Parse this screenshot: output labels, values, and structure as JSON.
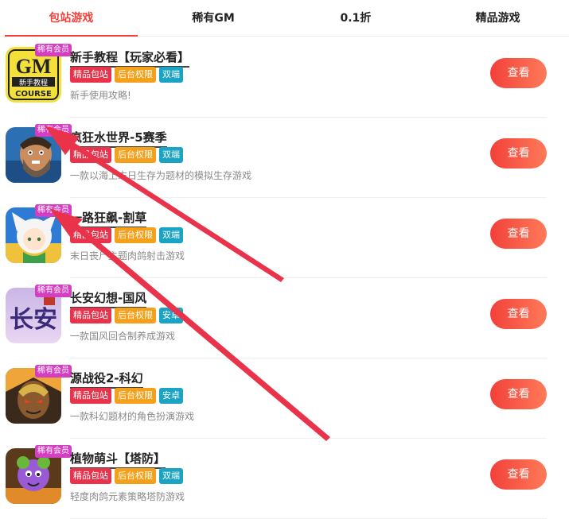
{
  "tabs": [
    {
      "label": "包站游戏",
      "active": true
    },
    {
      "label": "稀有GM",
      "active": false
    },
    {
      "label": "0.1折",
      "active": false
    },
    {
      "label": "精品游戏",
      "active": false
    }
  ],
  "colors": {
    "accent": "#f2403a",
    "vip": "#d33fc0",
    "tag_red": "#e8334a",
    "tag_orange": "#f5a01a",
    "tag_teal": "#1ba3c3",
    "arrow": "#e8334a"
  },
  "games": [
    {
      "title": "新手教程【玩家必看】",
      "vip": "稀有会员",
      "tags": [
        "精品包站",
        "后台权限",
        "双端"
      ],
      "desc": "新手使用攻略!",
      "button": "查看",
      "icon": "gm-course-icon",
      "icon_text_top": "GM",
      "icon_text_mid": "新手教程",
      "icon_text_bottom": "COURSE"
    },
    {
      "title": "疯狂水世界-5赛季",
      "vip": "稀有会员",
      "tags": [
        "精品包站",
        "后台权限",
        "双端"
      ],
      "desc": "一款以海上末日生存为题材的模拟生存游戏",
      "button": "查看",
      "icon": "bearded-man-icon"
    },
    {
      "title": "一路狂飙-割草",
      "vip": "稀有会员",
      "tags": [
        "精品包站",
        "后台权限",
        "双端"
      ],
      "desc": "末日丧尸主题肉鸽射击游戏",
      "button": "查看",
      "icon": "anime-girl-icon"
    },
    {
      "title": "长安幻想-国风",
      "vip": "稀有会员",
      "tags": [
        "精品包站",
        "后台权限",
        "安卓"
      ],
      "desc": "一款国风回合制养成游戏",
      "button": "查看",
      "icon": "changan-icon",
      "icon_text": "长安"
    },
    {
      "title": "源战役2-科幻",
      "vip": "稀有会员",
      "tags": [
        "精品包站",
        "后台权限",
        "安卓"
      ],
      "desc": "一款科幻题材的角色扮演游戏",
      "button": "查看",
      "icon": "warrior-icon"
    },
    {
      "title": "植物萌斗【塔防】",
      "vip": "稀有会员",
      "tags": [
        "精品包站",
        "后台权限",
        "双端"
      ],
      "desc": "轻度肉鸽元素策略塔防游戏",
      "button": "查看",
      "icon": "plant-icon"
    }
  ]
}
